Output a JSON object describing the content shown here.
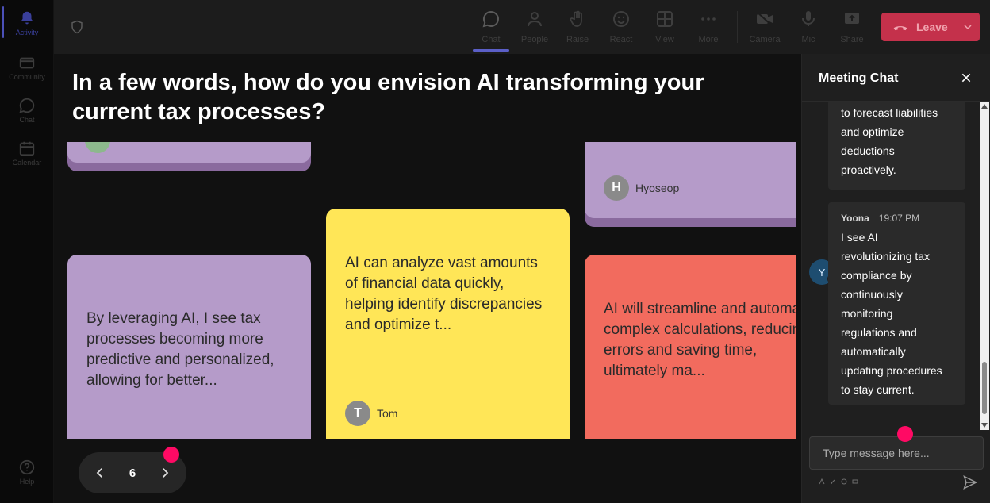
{
  "rail": {
    "items": [
      {
        "label": "Activity",
        "icon": "bell-icon",
        "active": true
      },
      {
        "label": "Community",
        "icon": "community-icon"
      },
      {
        "label": "Chat",
        "icon": "chat-icon"
      },
      {
        "label": "Calendar",
        "icon": "calendar-icon"
      }
    ],
    "help_label": "Help"
  },
  "toolbar": {
    "chat": "Chat",
    "people": "People",
    "raise": "Raise",
    "react": "React",
    "view": "View",
    "more": "More",
    "camera": "Camera",
    "mic": "Mic",
    "share": "Share",
    "leave": "Leave"
  },
  "stage": {
    "question": "In a few words, how do you envision AI transforming your current tax processes?",
    "cards": [
      {
        "text": "By leveraging AI, I see tax processes becoming more predictive and personalized, allowing for better...",
        "color": "#b59bc9"
      },
      {
        "text": "AI can analyze vast amounts of financial data quickly, helping identify discrepancies and optimize t...",
        "author": "Tom",
        "initial": "T",
        "color": "#ffe657"
      },
      {
        "text": "AI will streamline and automate complex calculations, reducing errors and saving time, ultimately ma...",
        "color": "#f26b5e"
      },
      {
        "author": "Hyoseop",
        "initial": "H",
        "color": "#b59bc9"
      }
    ],
    "page": "6"
  },
  "chat": {
    "title": "Meeting Chat",
    "messages": [
      {
        "lines": [
          "to forecast liabilities",
          "and optimize",
          "deductions",
          "proactively."
        ]
      },
      {
        "name": "Yoona",
        "initial": "Y",
        "time": "19:07 PM",
        "lines": [
          "I see AI",
          "revolutionizing tax",
          "compliance by",
          "continuously",
          "monitoring",
          "regulations and",
          "automatically",
          "updating procedures",
          "to stay current."
        ]
      }
    ],
    "input_placeholder": "Type message here..."
  }
}
